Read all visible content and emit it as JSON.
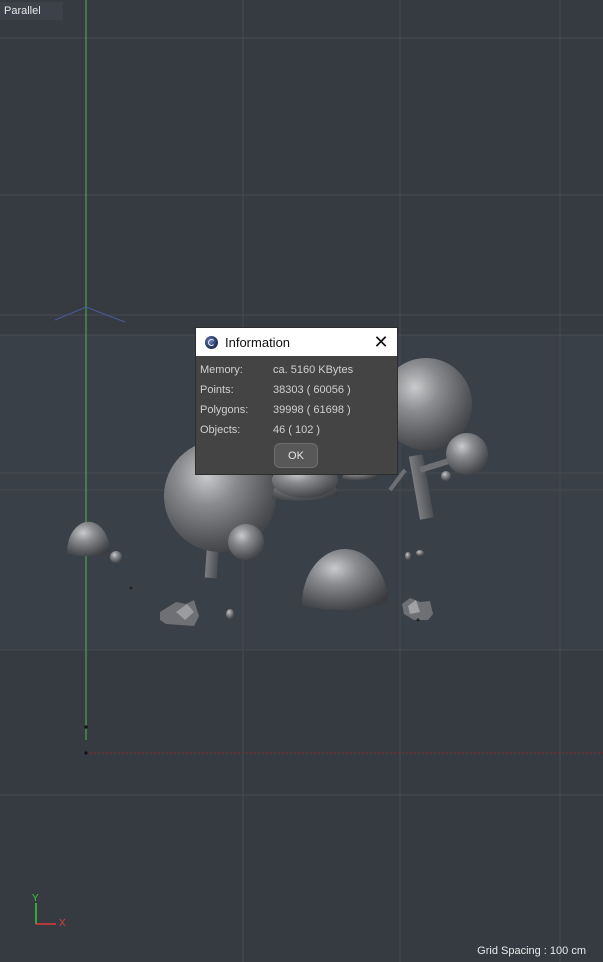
{
  "viewport": {
    "view_mode": "Parallel",
    "grid_spacing": "Grid Spacing : 100 cm",
    "axis_y_label": "Y",
    "axis_x_label": "X"
  },
  "dialog": {
    "title": "Information",
    "rows": [
      {
        "label": "Memory:",
        "value": "ca. 5160 KBytes"
      },
      {
        "label": "Points:",
        "value": "38303 ( 60056 )"
      },
      {
        "label": "Polygons:",
        "value": "39998 ( 61698 )"
      },
      {
        "label": "Objects:",
        "value": "46 ( 102 )"
      }
    ],
    "ok_label": "OK"
  },
  "colors": {
    "viewport_bg": "#363b42",
    "y_axis": "#3ec83e",
    "x_axis": "#e03a3a"
  }
}
